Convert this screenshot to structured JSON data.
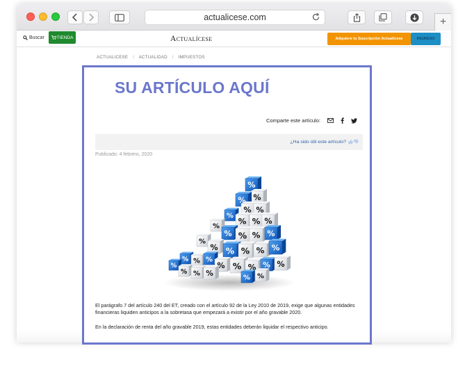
{
  "browser": {
    "url": "actualicese.com",
    "new_tab_symbol": "+"
  },
  "site_nav": {
    "search_label": "Buscar",
    "store_label": "TIENDA",
    "logo_text": "Actualícese",
    "subscribe_label": "Adquiere tu Suscripción Actualícese",
    "login_label": "INGRESO"
  },
  "breadcrumb": [
    "ACTUALICESE",
    "ACTUALIDAD",
    "IMPUESTOS"
  ],
  "breadcrumb_separator": "/",
  "article": {
    "placeholder_title": "SU ARTÍCULO AQUÍ",
    "share_label": "Comparte este artículo:",
    "useful_label": "¿Ha sido útil este artículo?",
    "published": "Publicado: 4 febrero, 2020",
    "paragraph_1": "El parágrafo 7 del artículo 240 del ET, creado con el artículo 92 de la Ley 2010 de 2019, exige que algunas entidades financieras liquiden anticipos a la sobretasa que empezará a existir por el año gravable 2020.",
    "paragraph_2": "En la declaración de renta del año gravable 2019, estas entidades deberán liquidar el respectivo anticipo.",
    "image_icon": "percent-cubes-image"
  },
  "colors": {
    "frame": "#6b77cc",
    "store": "#208a2e",
    "subscribe": "#f29400",
    "login": "#1d8fc4",
    "link": "#2b5fa8",
    "cube_blue": "#1e73d6"
  }
}
